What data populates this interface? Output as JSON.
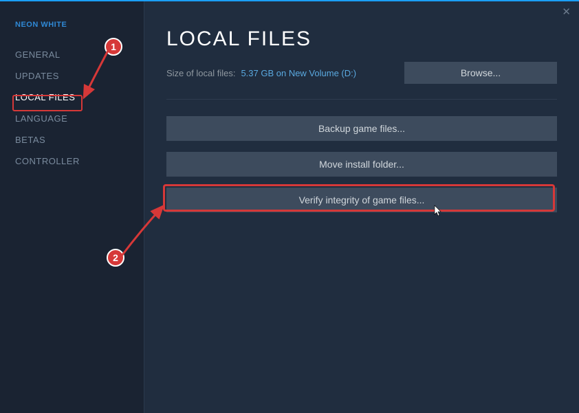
{
  "header": {
    "game_title": "NEON WHITE"
  },
  "sidebar": {
    "items": [
      {
        "label": "GENERAL"
      },
      {
        "label": "UPDATES"
      },
      {
        "label": "LOCAL FILES"
      },
      {
        "label": "LANGUAGE"
      },
      {
        "label": "BETAS"
      },
      {
        "label": "CONTROLLER"
      }
    ]
  },
  "main": {
    "title": "LOCAL FILES",
    "size_label": "Size of local files:",
    "size_value": "5.37 GB on New Volume (D:)",
    "browse_label": "Browse...",
    "backup_label": "Backup game files...",
    "move_label": "Move install folder...",
    "verify_label": "Verify integrity of game files..."
  },
  "annotations": {
    "callout_1": "1",
    "callout_2": "2"
  }
}
